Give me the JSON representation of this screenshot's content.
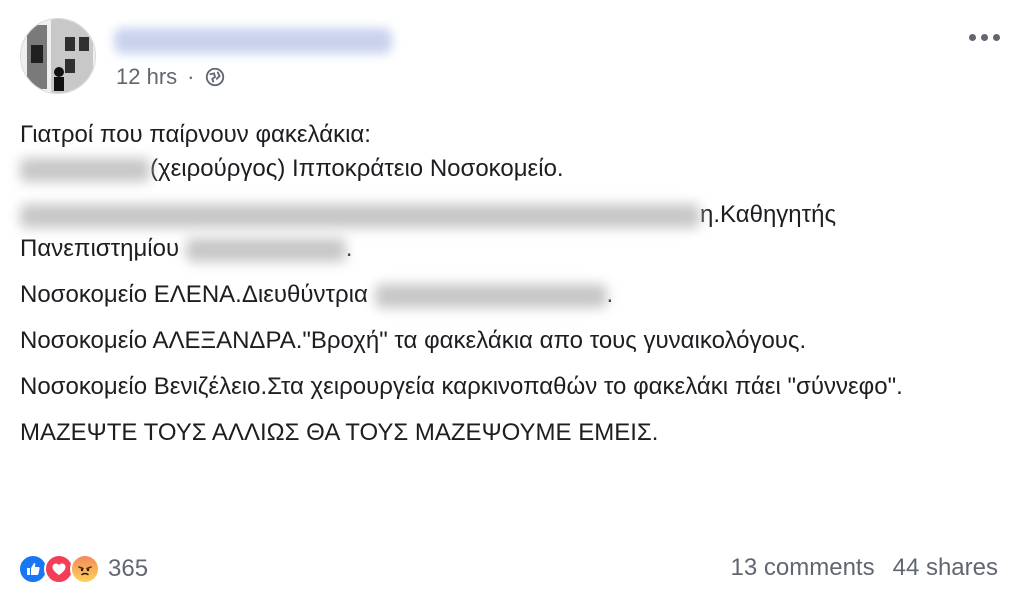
{
  "post": {
    "timestamp": "12 hrs",
    "separator": "·",
    "privacy_icon": "globe-icon",
    "options_icon": "more-options-icon",
    "lines": {
      "l1": "Γιατροί που παίρνουν φακελάκια:",
      "l2": "(χειρούργος) Ιπποκράτειο Νοσοκομείο.",
      "l3a": "η.Καθηγητής",
      "l3b": "Πανεπιστημίου",
      "l3c": ".",
      "l4a": "Νοσοκομείο ΕΛΕΝΑ.Διευθύντρια",
      "l4b": ".",
      "l5": "Νοσοκομείο ΑΛΕΞΑΝΔΡΑ.\"Βροχή\" τα φακελάκια απο τους γυναικολόγους.",
      "l6": "Νοσοκομείο Βενιζέλειο.Στα χειρουργεία καρκινοπαθών το φακελάκι πάει \"σύννεφο\".",
      "l7": "ΜΑΖΕΨΤΕ ΤΟΥΣ ΑΛΛΙΩΣ ΘΑ ΤΟΥΣ ΜΑΖΕΨΟΥΜΕ ΕΜΕΙΣ."
    }
  },
  "footer": {
    "reaction_icons": [
      "like-reaction-icon",
      "love-reaction-icon",
      "angry-reaction-icon"
    ],
    "reaction_count": "365",
    "comments": "13 comments",
    "shares": "44 shares"
  },
  "colors": {
    "like": "#1877f2",
    "love": "#f33e58",
    "muted_text": "#606770"
  }
}
